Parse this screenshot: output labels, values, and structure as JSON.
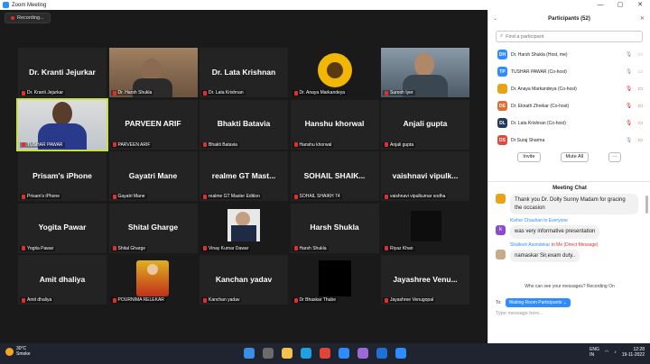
{
  "window": {
    "title": "Zoom Meeting",
    "minimize": "—",
    "maximize": "▢",
    "close": "✕"
  },
  "recording": {
    "label": "Recording..."
  },
  "tiles": [
    {
      "name": "Dr. Kranti Jejurkar",
      "label": "Dr. Kranti Jejurkar",
      "kind": "name"
    },
    {
      "name": "",
      "label": "Dr. Harsh Shukla",
      "kind": "photo",
      "photo": "man-room"
    },
    {
      "name": "Dr. Lata Krishnan",
      "label": "Dr. Lata Krishnan",
      "kind": "name"
    },
    {
      "name": "",
      "label": "Dr. Anaya Markandeya",
      "kind": "photo",
      "photo": "sunflower"
    },
    {
      "name": "",
      "label": "Suresh Iyer",
      "kind": "photo",
      "photo": "man-office"
    },
    {
      "name": "",
      "label": "TUSHAR PAWAR",
      "kind": "photo",
      "photo": "man-speaker",
      "active": true
    },
    {
      "name": "PARVEEN ARIF",
      "label": "PARVEEN ARIF",
      "kind": "name"
    },
    {
      "name": "Bhakti Batavia",
      "label": "Bhakti Batavia",
      "kind": "name"
    },
    {
      "name": "Hanshu khorwal",
      "label": "Hanshu khorwal",
      "kind": "name"
    },
    {
      "name": "Anjali gupta",
      "label": "Anjali gupta",
      "kind": "name"
    },
    {
      "name": "Prisam's iPhone",
      "label": "Prisam's iPhone",
      "kind": "name"
    },
    {
      "name": "Gayatri Mane",
      "label": "Gayatri Mane",
      "kind": "name"
    },
    {
      "name": "realme GT Mast...",
      "label": "realme GT Master Edition",
      "kind": "name"
    },
    {
      "name": "SOHAIL SHAIK...",
      "label": "SOHAIL SHAIKH 74",
      "kind": "name"
    },
    {
      "name": "vaishnavi vipulk...",
      "label": "vaishnavi vipulkumar sodha",
      "kind": "name"
    },
    {
      "name": "Yogita Pawar",
      "label": "Yogita Pawar",
      "kind": "name"
    },
    {
      "name": "Shital Gharge",
      "label": "Shital Gharge",
      "kind": "name"
    },
    {
      "name": "",
      "label": "Vinay Kumar Dawar",
      "kind": "photo",
      "photo": "man-suit"
    },
    {
      "name": "Harsh Shukla",
      "label": "Harsh Shukla",
      "kind": "name"
    },
    {
      "name": "",
      "label": "Riyaz Khan",
      "kind": "photo",
      "photo": "dark"
    },
    {
      "name": "Amit dhaliya",
      "label": "Amit dhaliya",
      "kind": "name"
    },
    {
      "name": "",
      "label": "POURNIMA RELEKAR",
      "kind": "photo",
      "photo": "deity"
    },
    {
      "name": "Kanchan yadav",
      "label": "Kanchan yadav",
      "kind": "name"
    },
    {
      "name": "",
      "label": "Dr Bhaskar Thube",
      "kind": "photo",
      "photo": "black"
    },
    {
      "name": "Jayashree Venu...",
      "label": "Jayashree Venugopal",
      "kind": "name"
    }
  ],
  "participants": {
    "title": "Participants (52)",
    "search_placeholder": "Find a participant",
    "list": [
      {
        "initials": "DH",
        "name": "Dr. Harsh Shukla (Host, me)",
        "color": "#2d8cff",
        "mic": "on",
        "cam": "on"
      },
      {
        "initials": "TP",
        "name": "TUSHAR PAWAR (Co-host)",
        "color": "#2d8cff",
        "mic": "on",
        "cam": "on"
      },
      {
        "initials": "",
        "name": "Dr. Anaya Markandeya (Co-host)",
        "color": "#e8a317",
        "mic": "off",
        "cam": "off"
      },
      {
        "initials": "DE",
        "name": "Dr. Eknath Zhrekar (Co-host)",
        "color": "#e06c2f",
        "mic": "off",
        "cam": "off"
      },
      {
        "initials": "DL",
        "name": "Dr. Lata Krishnan (Co-host)",
        "color": "#1f3b5a",
        "mic": "off",
        "cam": "off"
      },
      {
        "initials": "DS",
        "name": "Dr Suraj Sharma",
        "color": "#e04a3a",
        "mic": "on",
        "cam": "off"
      }
    ],
    "invite": "Invite",
    "mute_all": "Mute All",
    "more": "···"
  },
  "chat": {
    "title": "Meeting Chat",
    "messages": [
      {
        "sender": "",
        "to": "",
        "text": "Thank you Dr. Dolly Sunny Madam for gracing the occasion",
        "avatar": "#e8a317"
      },
      {
        "sender": "Kishor Chauhan",
        "to": "to Everyone",
        "text": "was very informative presentation",
        "avatar": "#8b4bd1",
        "initial": "k"
      },
      {
        "sender": "Shailesh Asondekar",
        "to": "to Me (Direct Message)",
        "text": "namaskar Sir,exam duty..",
        "avatar": "#c9a98a"
      }
    ],
    "notice": "Who can see your messages? Recording On",
    "to_label": "To:",
    "to_target": "Waiting Room Participants",
    "input_placeholder": "Type message here..."
  },
  "taskbar": {
    "temp": "30°C",
    "weather": "Smoke",
    "lang": "ENG",
    "region": "IN",
    "time": "12:28",
    "date": "19-11-2022"
  }
}
